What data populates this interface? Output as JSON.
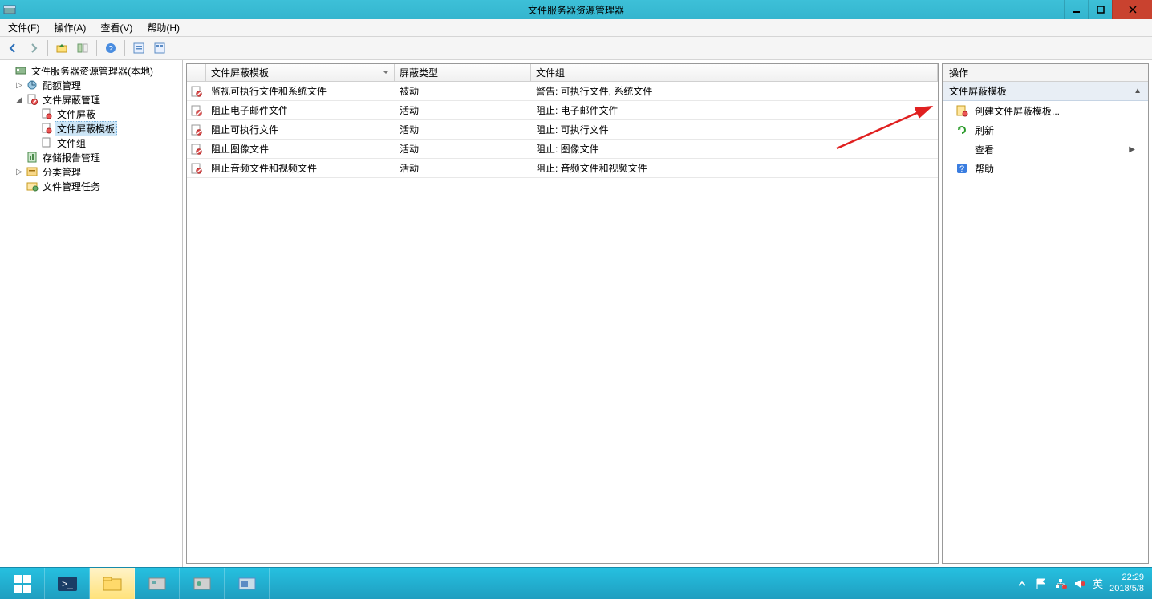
{
  "window": {
    "title": "文件服务器资源管理器"
  },
  "menu": {
    "file": "文件(F)",
    "action": "操作(A)",
    "view": "查看(V)",
    "help": "帮助(H)"
  },
  "tree": {
    "root": "文件服务器资源管理器(本地)",
    "quota": "配额管理",
    "screen_mgmt": "文件屏蔽管理",
    "screens": "文件屏蔽",
    "templates": "文件屏蔽模板",
    "groups": "文件组",
    "reports": "存储报告管理",
    "classification": "分类管理",
    "tasks": "文件管理任务"
  },
  "table": {
    "col_template": "文件屏蔽模板",
    "col_type": "屏蔽类型",
    "col_groups": "文件组",
    "rows": [
      {
        "name": "监视可执行文件和系统文件",
        "type": "被动",
        "groups": "警告: 可执行文件, 系统文件"
      },
      {
        "name": "阻止电子邮件文件",
        "type": "活动",
        "groups": "阻止: 电子邮件文件"
      },
      {
        "name": "阻止可执行文件",
        "type": "活动",
        "groups": "阻止: 可执行文件"
      },
      {
        "name": "阻止图像文件",
        "type": "活动",
        "groups": "阻止: 图像文件"
      },
      {
        "name": "阻止音频文件和视频文件",
        "type": "活动",
        "groups": "阻止: 音频文件和视频文件"
      }
    ]
  },
  "actions": {
    "header": "操作",
    "group": "文件屏蔽模板",
    "create": "创建文件屏蔽模板...",
    "refresh": "刷新",
    "view": "查看",
    "help": "帮助"
  },
  "taskbar": {
    "ime": "英",
    "time": "22:29",
    "date": "2018/5/8"
  }
}
